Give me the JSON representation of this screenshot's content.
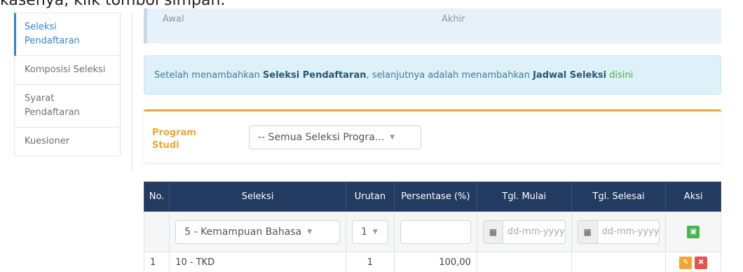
{
  "top_text": "kasenya, klik tombol simpan.",
  "sidebar": {
    "items": [
      {
        "label": "Seleksi Pendaftaran",
        "active": true
      },
      {
        "label": "Komposisi Seleksi",
        "active": false
      },
      {
        "label": "Syarat Pendaftaran",
        "active": false
      },
      {
        "label": "Kuesioner",
        "active": false
      }
    ]
  },
  "info_top": {
    "awal": "Awal",
    "akhir": "Akhir"
  },
  "alert": {
    "p1": "Setelah menambahkan ",
    "b1": "Seleksi Pendaftaran",
    "p2": ", selanjutnya adalah menambahkan ",
    "b2": "Jadwal Seleksi",
    "link": "disini"
  },
  "filter": {
    "label": "Program Studi",
    "selected": "-- Semua Seleksi Progra..."
  },
  "table": {
    "headers": [
      "No.",
      "Seleksi",
      "Urutan",
      "Persentase (%)",
      "Tgl. Mulai",
      "Tgl. Selesai",
      "Aksi"
    ],
    "input_row": {
      "seleksi": "5 - Kemampuan Bahasa",
      "urutan": "1",
      "date_placeholder": "dd-mm-yyyy"
    },
    "rows": [
      {
        "no": "1",
        "seleksi": "10 - TKD",
        "urutan": "1",
        "persentase": "100,00",
        "mulai": "",
        "selesai": ""
      }
    ]
  },
  "colors": {
    "accent": "#2e87c9",
    "header": "#233b61",
    "warning": "#f0a732",
    "success": "#45b64a",
    "danger": "#e5534b"
  },
  "icons": {
    "calendar": "calendar-icon",
    "save": "save-icon",
    "edit": "pencil-icon",
    "delete": "trash-icon"
  }
}
